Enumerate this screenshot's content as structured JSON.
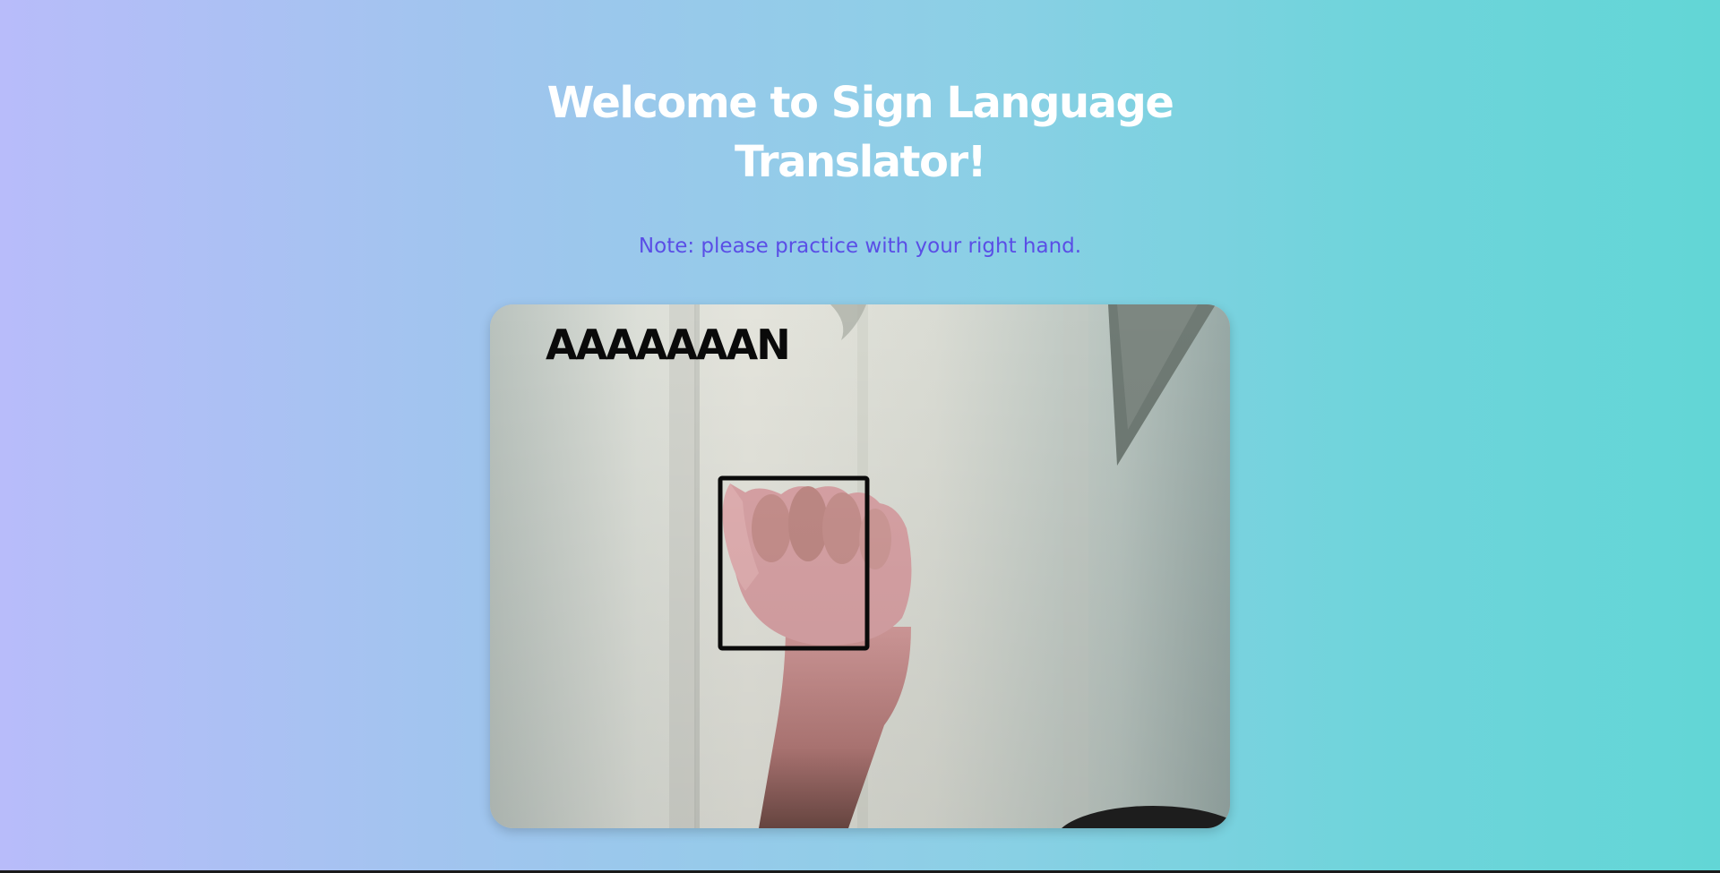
{
  "header": {
    "title_line1": "Welcome to Sign Language",
    "title_line2": "Translator!",
    "note": "Note: please practice with your right hand."
  },
  "video": {
    "prediction_text": "AAAAAAAN"
  },
  "colors": {
    "gradient_start": "#b8bcfa",
    "gradient_end": "#62d6d6",
    "title": "#ffffff",
    "note": "#5a4ee6",
    "overlay_text": "#0a0a0a"
  }
}
